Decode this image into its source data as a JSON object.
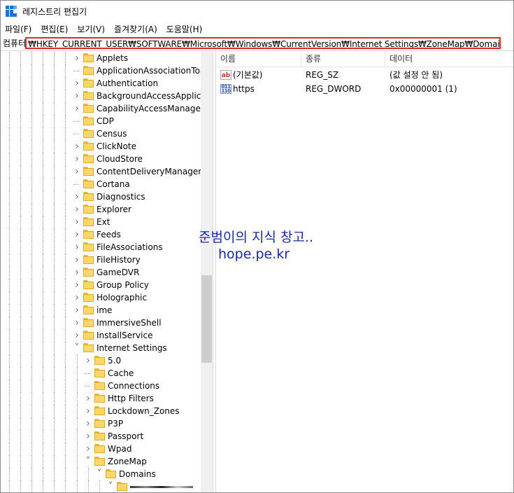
{
  "window": {
    "title": "레지스트리 편집기"
  },
  "menu": [
    "파일(F)",
    "편집(E)",
    "보기(V)",
    "즐겨찾기(A)",
    "도움말(H)"
  ],
  "address": {
    "prefix": "컴퓨터",
    "path": "₩HKEY_CURRENT_USER₩SOFTWARE₩Microsoft₩Windows₩CurrentVersion₩Internet Settings₩ZoneMap₩Domains₩"
  },
  "tree": [
    {
      "label": "Applets",
      "expandable": true
    },
    {
      "label": "ApplicationAssociationToasts",
      "expandable": false
    },
    {
      "label": "Authentication",
      "expandable": true
    },
    {
      "label": "BackgroundAccessApplications",
      "expandable": true
    },
    {
      "label": "CapabilityAccessManager",
      "expandable": true
    },
    {
      "label": "CDP",
      "expandable": false
    },
    {
      "label": "Census",
      "expandable": false
    },
    {
      "label": "ClickNote",
      "expandable": true
    },
    {
      "label": "CloudStore",
      "expandable": true
    },
    {
      "label": "ContentDeliveryManager",
      "expandable": true
    },
    {
      "label": "Cortana",
      "expandable": false
    },
    {
      "label": "Diagnostics",
      "expandable": true
    },
    {
      "label": "Explorer",
      "expandable": true
    },
    {
      "label": "Ext",
      "expandable": true
    },
    {
      "label": "Feeds",
      "expandable": true
    },
    {
      "label": "FileAssociations",
      "expandable": true
    },
    {
      "label": "FileHistory",
      "expandable": true
    },
    {
      "label": "GameDVR",
      "expandable": true
    },
    {
      "label": "Group Policy",
      "expandable": true
    },
    {
      "label": "Holographic",
      "expandable": true
    },
    {
      "label": "ime",
      "expandable": true
    },
    {
      "label": "ImmersiveShell",
      "expandable": true
    },
    {
      "label": "InstallService",
      "expandable": true
    },
    {
      "label": "Internet Settings",
      "expandable": true,
      "expanded": true
    },
    {
      "label": "5.0",
      "expandable": true,
      "level": 1
    },
    {
      "label": "Cache",
      "expandable": false,
      "level": 1
    },
    {
      "label": "Connections",
      "expandable": false,
      "level": 1
    },
    {
      "label": "Http Filters",
      "expandable": true,
      "level": 1
    },
    {
      "label": "Lockdown_Zones",
      "expandable": true,
      "level": 1
    },
    {
      "label": "P3P",
      "expandable": true,
      "level": 1
    },
    {
      "label": "Passport",
      "expandable": true,
      "level": 1
    },
    {
      "label": "Wpad",
      "expandable": true,
      "level": 1
    },
    {
      "label": "ZoneMap",
      "expandable": true,
      "expanded": true,
      "level": 1
    },
    {
      "label": "Domains",
      "expandable": true,
      "expanded": true,
      "level": 2
    },
    {
      "label": "",
      "expandable": true,
      "expanded": true,
      "level": 3,
      "redacted": true
    }
  ],
  "list": {
    "columns": [
      "이름",
      "종류",
      "데이터"
    ],
    "rows": [
      {
        "icon": "string-value-icon",
        "name": "(기본값)",
        "type": "REG_SZ",
        "data": "(값 설정 안 됨)"
      },
      {
        "icon": "binary-value-icon",
        "name": "https",
        "type": "REG_DWORD",
        "data": "0x00000001 (1)"
      }
    ]
  },
  "watermark": {
    "line1": "준범이의 지식 창고..",
    "line2": "hope.pe.kr"
  }
}
